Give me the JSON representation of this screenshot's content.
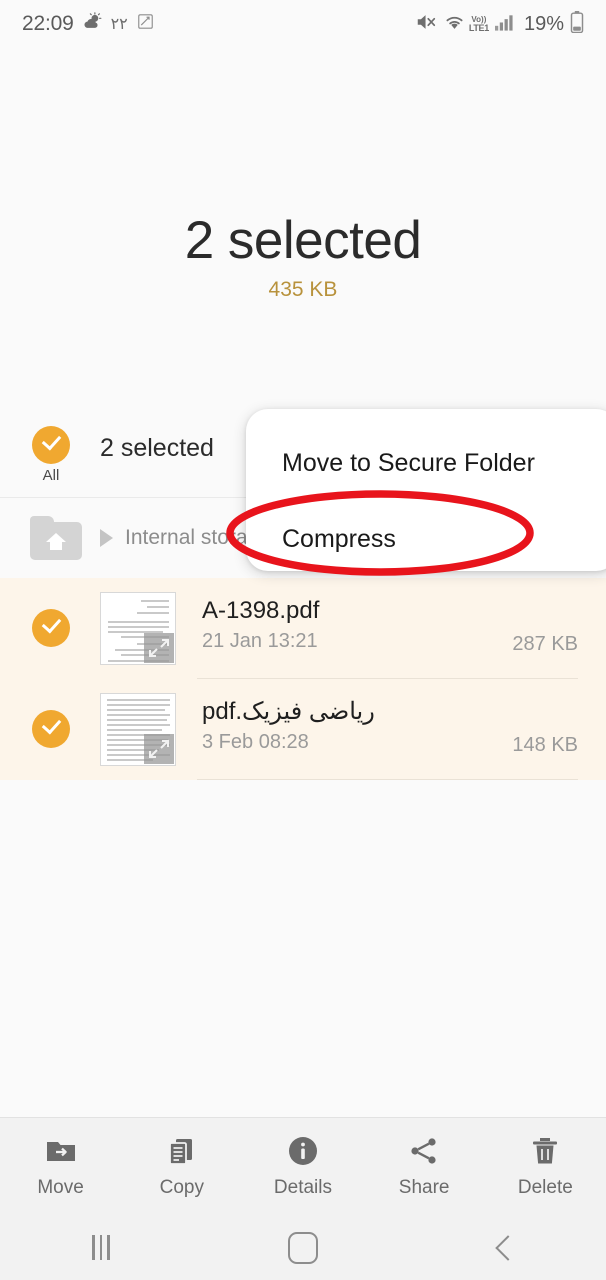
{
  "status_bar": {
    "clock": "22:09",
    "temperature": "۲۲",
    "weather_icon": "sun-behind-cloud-icon",
    "edit_icon": "screenshot-edit-icon",
    "mute_icon": "mute-icon",
    "wifi_icon": "wifi-icon",
    "volte_top": "Vo))",
    "volte_bottom": "LTE1",
    "signal_icon": "signal-bars-icon",
    "battery_percent": "19%",
    "battery_icon": "battery-icon"
  },
  "header": {
    "title": "2 selected",
    "total_size": "435 KB",
    "accent_color": "#b8923c"
  },
  "select_all": {
    "checkbox_state": "checked",
    "label": "All",
    "count_text": "2 selected",
    "checkbox_color": "#f0a830"
  },
  "breadcrumb": {
    "home_icon": "home-folder-icon",
    "separator_icon": "triangle-right-icon",
    "path_label": "Internal storage"
  },
  "popup_menu": {
    "items": [
      {
        "label": "Move to Secure Folder"
      },
      {
        "label": "Compress"
      }
    ]
  },
  "annotation": {
    "shape": "ellipse",
    "color": "#e8141c",
    "target": "Compress"
  },
  "file_list": {
    "row_background": "#fdf5ea",
    "files": [
      {
        "name": "A-1398.pdf",
        "date": "21 Jan 13:21",
        "size": "287 KB",
        "selected": true,
        "thumbnail": "pdf-page-thumbnail"
      },
      {
        "name": "ریاضی فیزیک.pdf",
        "date": "3 Feb 08:28",
        "size": "148 KB",
        "selected": true,
        "thumbnail": "pdf-page-thumbnail"
      }
    ]
  },
  "bottom_toolbar": {
    "items": [
      {
        "label": "Move",
        "icon": "move-folder-icon"
      },
      {
        "label": "Copy",
        "icon": "copy-icon"
      },
      {
        "label": "Details",
        "icon": "info-icon"
      },
      {
        "label": "Share",
        "icon": "share-icon"
      },
      {
        "label": "Delete",
        "icon": "trash-icon"
      }
    ]
  },
  "nav_bar": {
    "recents": "recents-icon",
    "home": "home-icon",
    "back": "back-icon"
  }
}
